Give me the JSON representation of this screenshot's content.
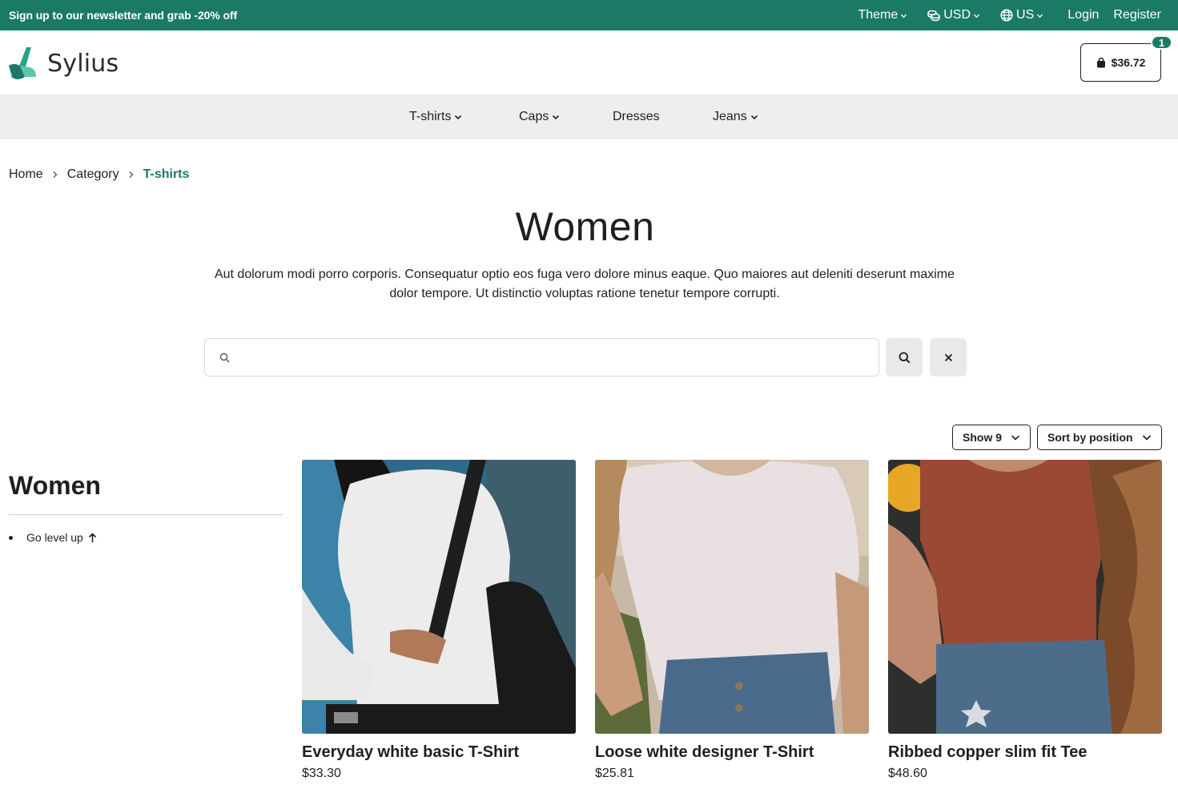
{
  "topbar": {
    "promo": "Sign up to our newsletter and grab -20% off",
    "theme_label": "Theme",
    "currency_label": "USD",
    "locale_label": "US",
    "login_label": "Login",
    "register_label": "Register"
  },
  "header": {
    "logo_text": "Sylius",
    "cart_total": "$36.72",
    "cart_count": "1"
  },
  "nav": {
    "items": [
      {
        "label": "T-shirts"
      },
      {
        "label": "Caps"
      },
      {
        "label": "Dresses"
      },
      {
        "label": "Jeans"
      }
    ]
  },
  "breadcrumb": {
    "items": [
      {
        "label": "Home"
      },
      {
        "label": "Category"
      },
      {
        "label": "T-shirts"
      }
    ]
  },
  "main": {
    "title": "Women",
    "description": "Aut dolorum modi porro corporis. Consequatur optio eos fuga vero dolore minus eaque. Quo maiores aut deleniti deserunt maxime dolor tempore. Ut distinctio voluptas ratione tenetur tempore corrupti.",
    "search": {
      "value": "",
      "placeholder": ""
    },
    "show_label": "Show 9",
    "sort_label": "Sort by position"
  },
  "sidebar": {
    "title": "Women",
    "items": [
      {
        "label": "Go level up"
      }
    ]
  },
  "products": [
    {
      "name": "Everyday white basic T-Shirt",
      "price": "$33.30"
    },
    {
      "name": "Loose white designer T-Shirt",
      "price": "$25.81"
    },
    {
      "name": "Ribbed copper slim fit Tee",
      "price": "$48.60"
    }
  ],
  "colors": {
    "brand": "#1b7a66",
    "nav_bg": "#eeeeee"
  },
  "icons": [
    "chevron-down-icon",
    "coins-icon",
    "globe-icon",
    "bag-icon",
    "chevron-right-icon",
    "search-icon",
    "close-icon",
    "arrow-up-icon"
  ]
}
